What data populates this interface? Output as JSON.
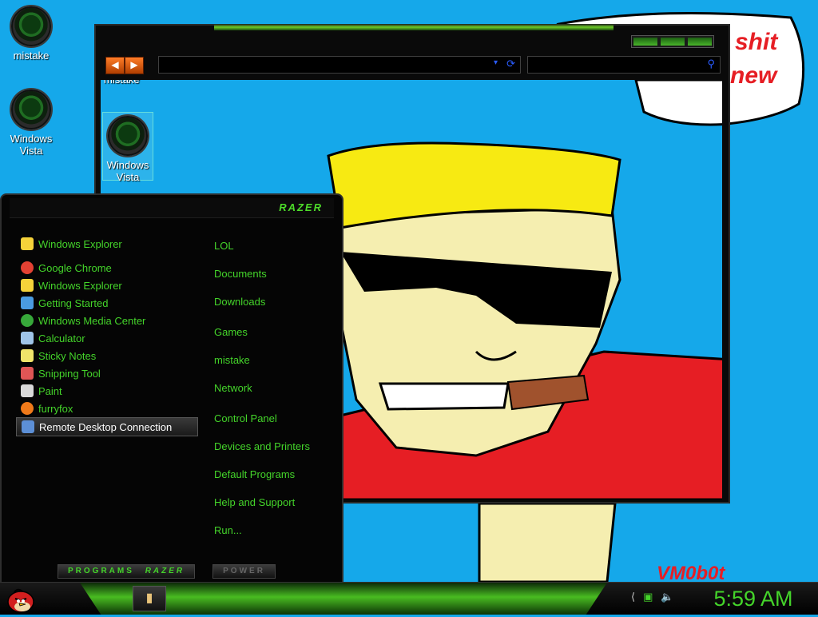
{
  "desktop": {
    "icons": [
      {
        "label": "mistake",
        "icon": "green-orb-icon"
      },
      {
        "label": "Windows Vista",
        "icon": "recycle-bin-icon"
      }
    ],
    "speech_bubble_text": [
      "shit",
      "new"
    ],
    "watermark": "VM0b0t"
  },
  "explorer": {
    "nav_back": "◀",
    "nav_forward": "▶",
    "address_value": "",
    "search_value": "",
    "selected_icon_label": "Windows Vista",
    "partial_label": "mistake"
  },
  "start_menu": {
    "brand": "RAZER",
    "pinned": [
      {
        "label": "Windows Explorer",
        "icon": "folder-icon",
        "color": "#f5d23a"
      }
    ],
    "recent": [
      {
        "label": "Google Chrome",
        "icon": "chrome-icon",
        "color": "#e34133"
      },
      {
        "label": "Windows Explorer",
        "icon": "folder-icon",
        "color": "#f5d23a"
      },
      {
        "label": "Getting Started",
        "icon": "getting-started-icon",
        "color": "#4a9be0"
      },
      {
        "label": "Windows Media Center",
        "icon": "media-center-icon",
        "color": "#37a83a"
      },
      {
        "label": "Calculator",
        "icon": "calculator-icon",
        "color": "#9fc4e8"
      },
      {
        "label": "Sticky Notes",
        "icon": "sticky-notes-icon",
        "color": "#f0e36a"
      },
      {
        "label": "Snipping Tool",
        "icon": "snipping-tool-icon",
        "color": "#e05555"
      },
      {
        "label": "Paint",
        "icon": "paint-icon",
        "color": "#d9d9d9"
      },
      {
        "label": "furryfox",
        "icon": "firefox-icon",
        "color": "#f07a1a"
      },
      {
        "label": "Remote Desktop Connection",
        "icon": "remote-desktop-icon",
        "color": "#5c8fd6"
      }
    ],
    "right_links": [
      "LOL",
      "Documents",
      "Downloads",
      "Games",
      "mistake",
      "Network",
      "Control Panel",
      "Devices and Printers",
      "Default Programs",
      "Help and Support",
      "Run..."
    ],
    "programs_label": "PROGRAMS",
    "programs_brand": "RAZER",
    "power_label": "POWER"
  },
  "taskbar": {
    "task_icon": "explorer-icon",
    "clock": "5:59 AM",
    "tray_icons": [
      "arrow-icon",
      "network-icon",
      "volume-icon"
    ]
  },
  "colors": {
    "accent": "#44d42a",
    "sky": "#15a8ea",
    "hair": "#f7ea12",
    "shirt": "#e61e24",
    "skin": "#f5eeb0"
  }
}
